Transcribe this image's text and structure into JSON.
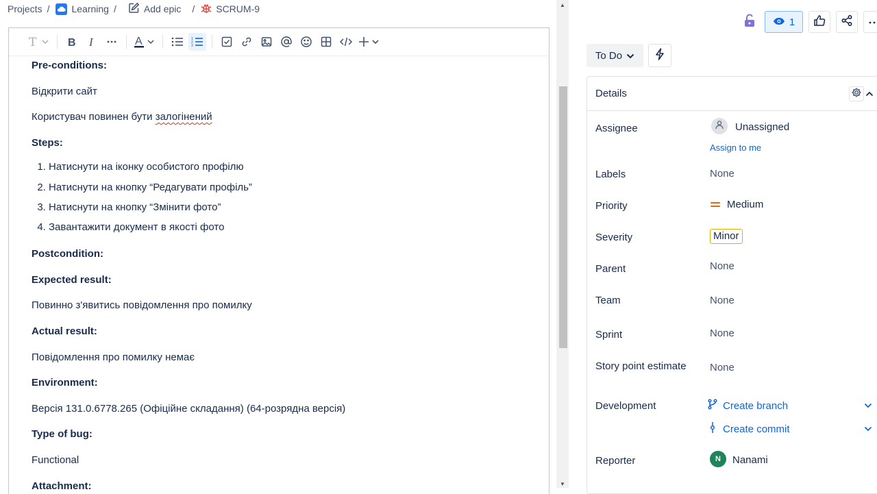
{
  "breadcrumb": {
    "projects": "Projects",
    "learning": "Learning",
    "add_epic": "Add epic",
    "issue_key": "SCRUM-9",
    "separator": "/"
  },
  "toolbar": {
    "text_style_icon": "text-style-icon",
    "items": [
      "bold",
      "italic",
      "more-formatting",
      "text-color",
      "bullet-list",
      "numbered-list",
      "task",
      "link",
      "image",
      "mention",
      "emoji",
      "table",
      "code",
      "insert"
    ]
  },
  "content": {
    "pre_conditions": "Pre-conditions:",
    "pre_1": "Відкрити сайт",
    "pre_2_a": "Користувач повинен бути ",
    "pre_2_b": "залогінений",
    "steps": "Steps:",
    "step_1": "Натиснути на іконку особистого профілю",
    "step_2": "Натиснути на кнопку “Редагувати профіль”",
    "step_3": "Натиснути на кнопку “Змінити фото”",
    "step_4": "Завантажити документ в якості фото",
    "postcondition": "Postcondition:",
    "expected": "Expected result:",
    "expected_text": "Повинно з'явитись повідомлення про помилку",
    "actual": "Actual result:",
    "actual_text": "Повідомлення про помилку немає",
    "environment": "Environment:",
    "environment_text": "Версія 131.0.6778.265 (Офіційне складання) (64-розрядна версія)",
    "type_of_bug": "Type of bug:",
    "type_text": "Functional",
    "attachment": "Attachment:"
  },
  "header_actions": {
    "watch_count": "1"
  },
  "status": {
    "label": "To Do"
  },
  "details": {
    "title": "Details",
    "assignee_label": "Assignee",
    "assignee_value": "Unassigned",
    "assign_to_me": "Assign to me",
    "labels_label": "Labels",
    "labels_value": "None",
    "priority_label": "Priority",
    "priority_value": "Medium",
    "severity_label": "Severity",
    "severity_value": "Minor",
    "parent_label": "Parent",
    "parent_value": "None",
    "team_label": "Team",
    "team_value": "None",
    "sprint_label": "Sprint",
    "sprint_value": "None",
    "story_points_label": "Story point estimate",
    "story_points_value": "None",
    "development_label": "Development",
    "create_branch": "Create branch",
    "create_commit": "Create commit",
    "reporter_label": "Reporter",
    "reporter_initial": "N",
    "reporter_name": "Nanami"
  },
  "colors": {
    "accent": "#0c66e4",
    "priority_medium": "#e56910",
    "severity_border": "#e2b203",
    "reporter_avatar": "#1f845a",
    "bug_icon": "#e2483d",
    "lock_icon": "#8270db"
  }
}
